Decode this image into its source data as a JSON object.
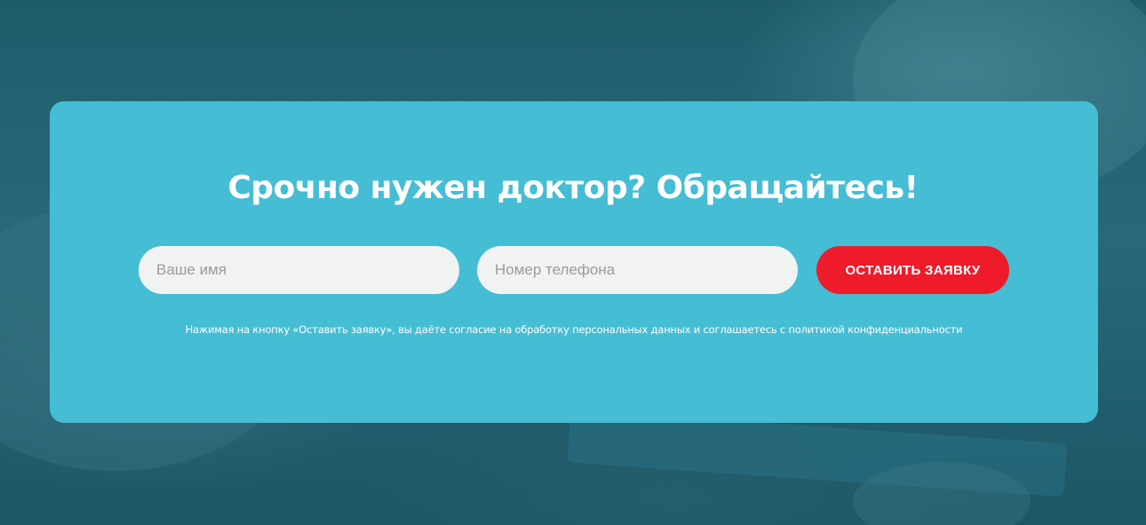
{
  "form": {
    "title": "Срочно нужен доктор? Обращайтесь!",
    "name_placeholder": "Ваше имя",
    "name_value": "",
    "phone_placeholder": "Номер телефона",
    "phone_value": "",
    "submit_label": "Оставить заявку",
    "consent_text": "Нажимая на кнопку «Оставить заявку», вы даёте согласие на обработку персональных данных и соглашаетесь с политикой конфиденциальности"
  },
  "colors": {
    "card_background": "#45bdd4",
    "submit_background": "#ee1c2b",
    "input_background": "#f1f3f2",
    "page_overlay": "#1f5c6a"
  }
}
